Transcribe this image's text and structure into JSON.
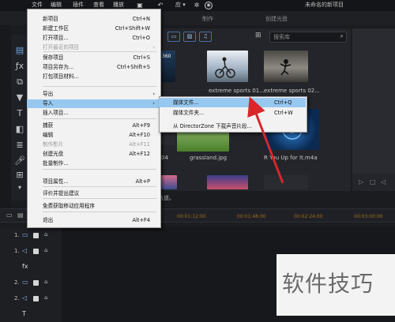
{
  "menubar": {
    "items": [
      "文件",
      "编辑",
      "插件",
      "查看",
      "播放"
    ],
    "mode_label": "应 ▾",
    "title": "未命名的新项目"
  },
  "tabs": {
    "produce": "制作",
    "create_disc": "创建光盘"
  },
  "library": {
    "search_placeholder": "搜索库",
    "items": [
      {
        "label": "",
        "kind": "video"
      },
      {
        "label": "extreme sports 01...",
        "kind": "bike"
      },
      {
        "label": "extreme sports 02...",
        "kind": "skate"
      },
      {
        "label": "04",
        "kind": "partial"
      },
      {
        "label": "grassland.jpg",
        "kind": "grass"
      },
      {
        "label": "R You Up for It.m4a",
        "kind": "audio"
      }
    ],
    "partial_labels": [
      "360"
    ]
  },
  "status_text": "轨道。",
  "timeline": {
    "ticks": [
      "00:01:12:00",
      "00:01:48:00",
      "00:02:24:00",
      "00:03:00:00"
    ],
    "tracks": [
      {
        "num": "1.",
        "icon": "video-track-icon"
      },
      {
        "num": "1.",
        "icon": "audio-track-icon"
      },
      {
        "num": "",
        "icon": "fx-track-icon",
        "icon_text": "fx"
      },
      {
        "num": "2.",
        "icon": "video-track-icon"
      },
      {
        "num": "2.",
        "icon": "audio-track-icon"
      },
      {
        "num": "",
        "icon": "title-track-icon",
        "icon_text": "T"
      }
    ]
  },
  "file_menu": [
    {
      "label": "新项目",
      "shortcut": "Ctrl+N"
    },
    {
      "label": "新建工作区",
      "shortcut": "Ctrl+Shift+W"
    },
    {
      "label": "打开项目...",
      "shortcut": "Ctrl+O"
    },
    {
      "label": "打开最近的项目",
      "shortcut": "",
      "disabled": true,
      "submenu": true
    },
    {
      "label": "保存项目",
      "shortcut": "Ctrl+S"
    },
    {
      "label": "项目另存为...",
      "shortcut": "Ctrl+Shift+S"
    },
    {
      "label": "打包项目材料...",
      "shortcut": ""
    },
    {
      "label": "导出",
      "shortcut": "",
      "submenu": true
    },
    {
      "label": "导入",
      "shortcut": "",
      "submenu": true,
      "highlighted": true
    },
    {
      "label": "插入项目...",
      "shortcut": ""
    },
    {
      "label": "捕获",
      "shortcut": "Alt+F9"
    },
    {
      "label": "编辑",
      "shortcut": "Alt+F10"
    },
    {
      "label": "制作影片",
      "shortcut": "Alt+F11",
      "disabled": true
    },
    {
      "label": "创建光盘",
      "shortcut": "Alt+F12"
    },
    {
      "label": "批量制作...",
      "shortcut": ""
    },
    {
      "label": "项目属性...",
      "shortcut": "Alt+P"
    },
    {
      "label": "评价并提出建议",
      "shortcut": ""
    },
    {
      "label": "免费获取移动应用程序",
      "shortcut": ""
    },
    {
      "label": "退出",
      "shortcut": "Alt+F4"
    }
  ],
  "import_submenu": [
    {
      "label": "媒体文件...",
      "shortcut": "Ctrl+Q",
      "highlighted": true
    },
    {
      "label": "媒体文件夹...",
      "shortcut": "Ctrl+W"
    },
    {
      "label": "从 DirectorZone 下载声音片段...",
      "shortcut": ""
    }
  ],
  "watermark": "软件技巧",
  "colors": {
    "menu_highlight": "#97c8f0",
    "annotation_arrow": "#d8262b",
    "timeline_time": "#a06a1a"
  }
}
